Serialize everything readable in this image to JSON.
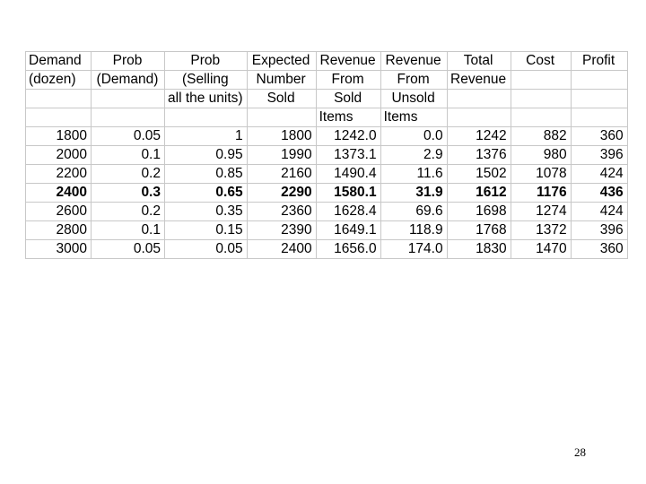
{
  "header_rows": [
    [
      "Demand",
      "Prob",
      "Prob",
      "Expected",
      "Revenue",
      "Revenue",
      "Total",
      "Cost",
      "Profit"
    ],
    [
      "(dozen)",
      "(Demand)",
      "(Selling",
      "Number",
      "From",
      "From",
      "Revenue",
      "",
      ""
    ],
    [
      "",
      "",
      "all the units)",
      "Sold",
      "Sold",
      "Unsold",
      "",
      "",
      ""
    ],
    [
      "",
      "",
      "",
      "",
      "Items",
      "Items",
      "",
      "",
      ""
    ]
  ],
  "data_rows": [
    [
      "1800",
      "0.05",
      "1",
      "1800",
      "1242.0",
      "0.0",
      "1242",
      "882",
      "360"
    ],
    [
      "2000",
      "0.1",
      "0.95",
      "1990",
      "1373.1",
      "2.9",
      "1376",
      "980",
      "396"
    ],
    [
      "2200",
      "0.2",
      "0.85",
      "2160",
      "1490.4",
      "11.6",
      "1502",
      "1078",
      "424"
    ],
    [
      "2400",
      "0.3",
      "0.65",
      "2290",
      "1580.1",
      "31.9",
      "1612",
      "1176",
      "436"
    ],
    [
      "2600",
      "0.2",
      "0.35",
      "2360",
      "1628.4",
      "69.6",
      "1698",
      "1274",
      "424"
    ],
    [
      "2800",
      "0.1",
      "0.15",
      "2390",
      "1649.1",
      "118.9",
      "1768",
      "1372",
      "396"
    ],
    [
      "3000",
      "0.05",
      "0.05",
      "2400",
      "1656.0",
      "174.0",
      "1830",
      "1470",
      "360"
    ]
  ],
  "highlighted_row_index": 3,
  "page_number": "28",
  "colors": {
    "gridline": "#c8c8c8",
    "text": "#000000",
    "background": "#ffffff"
  }
}
